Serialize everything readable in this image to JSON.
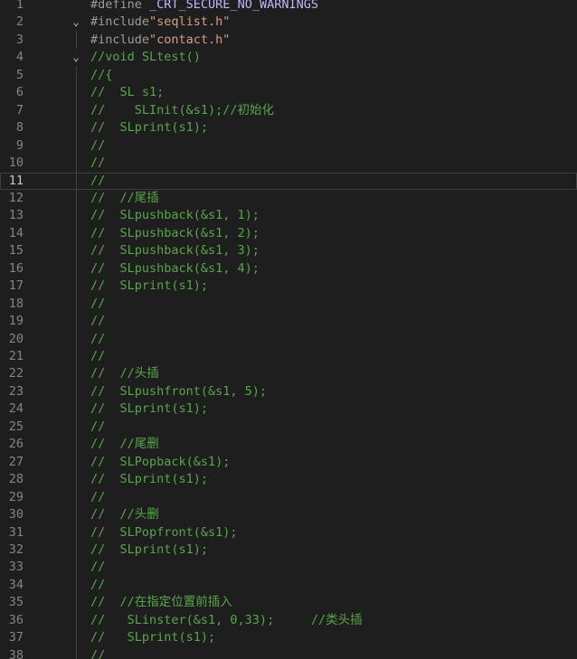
{
  "editor": {
    "lines": [
      {
        "n": "1",
        "fold": "",
        "tokens": [
          {
            "t": "#define ",
            "c": "pre"
          },
          {
            "t": "_CRT_SECURE_NO_WARNINGS",
            "c": "define"
          }
        ]
      },
      {
        "n": "2",
        "fold": "⌄",
        "tokens": [
          {
            "t": "#include",
            "c": "pre"
          },
          {
            "t": "\"seqlist.h\"",
            "c": "str"
          }
        ]
      },
      {
        "n": "3",
        "fold": "",
        "tokens": [
          {
            "t": "#include",
            "c": "pre"
          },
          {
            "t": "\"contact.h\"",
            "c": "str"
          }
        ]
      },
      {
        "n": "4",
        "fold": "⌄",
        "tokens": [
          {
            "t": "//void SLtest()",
            "c": "comment"
          }
        ]
      },
      {
        "n": "5",
        "fold": "",
        "tokens": [
          {
            "t": "//{",
            "c": "comment"
          }
        ]
      },
      {
        "n": "6",
        "fold": "",
        "tokens": [
          {
            "t": "//  SL s1;",
            "c": "comment"
          }
        ]
      },
      {
        "n": "7",
        "fold": "",
        "tokens": [
          {
            "t": "//    SLInit(&s1);//初始化",
            "c": "comment"
          }
        ]
      },
      {
        "n": "8",
        "fold": "",
        "tokens": [
          {
            "t": "//  SLprint(s1);",
            "c": "comment"
          }
        ]
      },
      {
        "n": "9",
        "fold": "",
        "tokens": [
          {
            "t": "//",
            "c": "comment"
          }
        ]
      },
      {
        "n": "10",
        "fold": "",
        "tokens": [
          {
            "t": "//",
            "c": "comment"
          }
        ]
      },
      {
        "n": "11",
        "fold": "",
        "current": true,
        "tokens": [
          {
            "t": "//",
            "c": "comment"
          }
        ]
      },
      {
        "n": "12",
        "fold": "",
        "tokens": [
          {
            "t": "//  //尾插",
            "c": "comment"
          }
        ]
      },
      {
        "n": "13",
        "fold": "",
        "tokens": [
          {
            "t": "//  SLpushback(&s1, 1);",
            "c": "comment"
          }
        ]
      },
      {
        "n": "14",
        "fold": "",
        "tokens": [
          {
            "t": "//  SLpushback(&s1, 2);",
            "c": "comment"
          }
        ]
      },
      {
        "n": "15",
        "fold": "",
        "tokens": [
          {
            "t": "//  SLpushback(&s1, 3);",
            "c": "comment"
          }
        ]
      },
      {
        "n": "16",
        "fold": "",
        "tokens": [
          {
            "t": "//  SLpushback(&s1, 4);",
            "c": "comment"
          }
        ]
      },
      {
        "n": "17",
        "fold": "",
        "tokens": [
          {
            "t": "//  SLprint(s1);",
            "c": "comment"
          }
        ]
      },
      {
        "n": "18",
        "fold": "",
        "tokens": [
          {
            "t": "//",
            "c": "comment"
          }
        ]
      },
      {
        "n": "19",
        "fold": "",
        "tokens": [
          {
            "t": "//",
            "c": "comment"
          }
        ]
      },
      {
        "n": "20",
        "fold": "",
        "tokens": [
          {
            "t": "//",
            "c": "comment"
          }
        ]
      },
      {
        "n": "21",
        "fold": "",
        "tokens": [
          {
            "t": "//",
            "c": "comment"
          }
        ]
      },
      {
        "n": "22",
        "fold": "",
        "tokens": [
          {
            "t": "//  //头插",
            "c": "comment"
          }
        ]
      },
      {
        "n": "23",
        "fold": "",
        "tokens": [
          {
            "t": "//  SLpushfront(&s1, 5);",
            "c": "comment"
          }
        ]
      },
      {
        "n": "24",
        "fold": "",
        "tokens": [
          {
            "t": "//  SLprint(s1);",
            "c": "comment"
          }
        ]
      },
      {
        "n": "25",
        "fold": "",
        "tokens": [
          {
            "t": "//",
            "c": "comment"
          }
        ]
      },
      {
        "n": "26",
        "fold": "",
        "tokens": [
          {
            "t": "//  //尾删",
            "c": "comment"
          }
        ]
      },
      {
        "n": "27",
        "fold": "",
        "tokens": [
          {
            "t": "//  SLPopback(&s1);",
            "c": "comment"
          }
        ]
      },
      {
        "n": "28",
        "fold": "",
        "tokens": [
          {
            "t": "//  SLprint(s1);",
            "c": "comment"
          }
        ]
      },
      {
        "n": "29",
        "fold": "",
        "tokens": [
          {
            "t": "//",
            "c": "comment"
          }
        ]
      },
      {
        "n": "30",
        "fold": "",
        "tokens": [
          {
            "t": "//  //头删",
            "c": "comment"
          }
        ]
      },
      {
        "n": "31",
        "fold": "",
        "tokens": [
          {
            "t": "//  SLPopfront(&s1);",
            "c": "comment"
          }
        ]
      },
      {
        "n": "32",
        "fold": "",
        "tokens": [
          {
            "t": "//  SLprint(s1);",
            "c": "comment"
          }
        ]
      },
      {
        "n": "33",
        "fold": "",
        "tokens": [
          {
            "t": "//",
            "c": "comment"
          }
        ]
      },
      {
        "n": "34",
        "fold": "",
        "tokens": [
          {
            "t": "//",
            "c": "comment"
          }
        ]
      },
      {
        "n": "35",
        "fold": "",
        "tokens": [
          {
            "t": "//  //在指定位置前插入",
            "c": "comment"
          }
        ]
      },
      {
        "n": "36",
        "fold": "",
        "tokens": [
          {
            "t": "//   SLinster(&s1, 0,33);     //类头插",
            "c": "comment"
          }
        ]
      },
      {
        "n": "37",
        "fold": "",
        "tokens": [
          {
            "t": "//   SLprint(s1);",
            "c": "comment"
          }
        ]
      },
      {
        "n": "38",
        "fold": "",
        "tokens": [
          {
            "t": "//",
            "c": "comment"
          }
        ]
      }
    ],
    "colors": {
      "background": "#1e1e1e",
      "line_number": "#858585",
      "comment": "#57a64a",
      "preprocessor": "#9b9b9b",
      "string": "#d69d85",
      "macro": "#beb7ff"
    }
  }
}
